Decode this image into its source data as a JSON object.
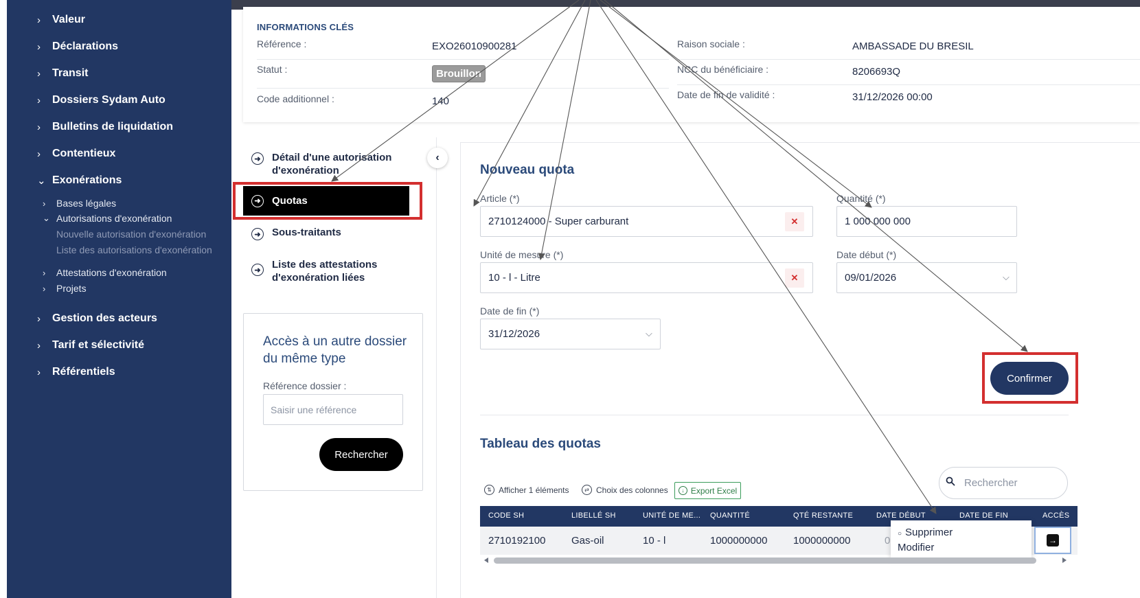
{
  "sidebar": {
    "items": [
      {
        "label": "Valeur"
      },
      {
        "label": "Déclarations"
      },
      {
        "label": "Transit"
      },
      {
        "label": "Dossiers Sydam Auto"
      },
      {
        "label": "Bulletins de liquidation"
      },
      {
        "label": "Contentieux"
      },
      {
        "label": "Exonérations"
      },
      {
        "label": "Gestion des acteurs"
      },
      {
        "label": "Tarif et sélectivité"
      },
      {
        "label": "Référentiels"
      }
    ],
    "exonerations_children": {
      "bases_legales": "Bases légales",
      "autorisations": "Autorisations d'exonération",
      "nouvelle": "Nouvelle autorisation d'exonération",
      "liste": "Liste des autorisations d'exonération",
      "attestations": "Attestations d'exonération",
      "projets": "Projets"
    }
  },
  "info": {
    "title": "INFORMATIONS CLÉS",
    "reference_label": "Référence :",
    "reference_value": "EXO26010900281",
    "statut_label": "Statut :",
    "statut_value": "Brouillon",
    "code_label": "Code additionnel :",
    "code_value": "140",
    "raison_label": "Raison sociale :",
    "raison_value": "AMBASSADE DU BRESIL",
    "ncc_label": "NCC du bénéficiaire :",
    "ncc_value": "8206693Q",
    "date_fin_label": "Date de fin de validité :",
    "date_fin_value": "31/12/2026 00:00"
  },
  "subnav": {
    "detail": "Détail d'une autorisation d'exonération",
    "quotas": "Quotas",
    "sous_traitants": "Sous-traitants",
    "attestations_liees": "Liste des attestations d'exonération liées"
  },
  "access": {
    "title": "Accès à un autre dossier du même type",
    "label": "Référence dossier :",
    "placeholder": "Saisir une référence",
    "button": "Rechercher"
  },
  "form": {
    "title": "Nouveau quota",
    "article_label": "Article (*)",
    "article_value": "2710124000 - Super carburant",
    "quantite_label": "Quantité (*)",
    "quantite_value": "1 000 000 000",
    "unite_label": "Unité de mesure (*)",
    "unite_value": "10 - l - Litre",
    "date_debut_label": "Date début (*)",
    "date_debut_value": "09/01/2026",
    "date_fin_label": "Date de fin (*)",
    "date_fin_value": "31/12/2026",
    "confirm_button": "Confirmer"
  },
  "table": {
    "title": "Tableau des quotas",
    "show_label": "Afficher 1 éléments",
    "columns_label": "Choix des colonnes",
    "export_label": "Export Excel",
    "search_placeholder": "Rechercher",
    "headers": [
      "CODE SH",
      "LIBELLÉ SH",
      "UNITÉ DE ME...",
      "QUANTITÉ",
      "QTÉ RESTANTE",
      "DATE DÉBUT",
      "DATE DE FIN",
      "ACCÈS"
    ],
    "row": [
      "2710192100",
      "Gas-oil",
      "10 - l",
      "1000000000",
      "1000000000",
      "0"
    ]
  },
  "popup": {
    "delete": "Supprimer",
    "edit": "Modifier"
  },
  "colors": {
    "sidebar": "#223763",
    "accent": "#2b4a7a",
    "highlight": "#d32f2f"
  }
}
